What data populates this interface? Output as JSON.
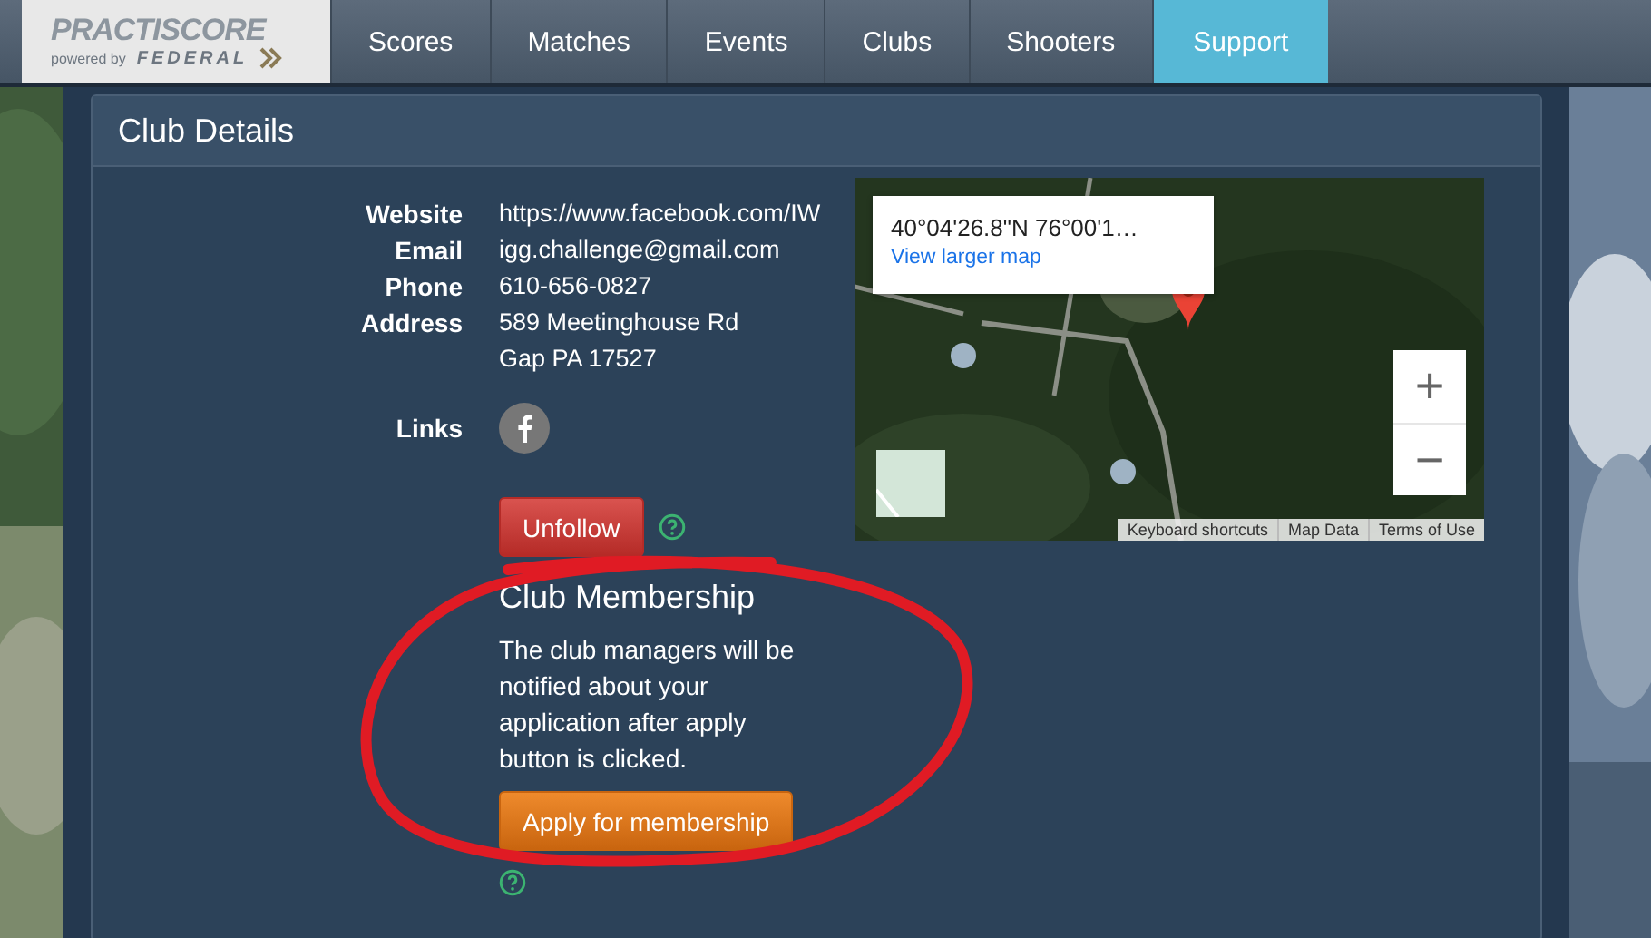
{
  "nav": {
    "logo": {
      "title": "PRACTISCORE",
      "tagline": "powered by",
      "brand": "FEDERAL"
    },
    "items": [
      {
        "label": "Scores",
        "selected": false
      },
      {
        "label": "Matches",
        "selected": false
      },
      {
        "label": "Events",
        "selected": false
      },
      {
        "label": "Clubs",
        "selected": false
      },
      {
        "label": "Shooters",
        "selected": false
      },
      {
        "label": "Support",
        "selected": true
      }
    ]
  },
  "panel": {
    "title": "Club Details",
    "details": [
      {
        "label": "Website",
        "lines": [
          "https://www.facebook.com/IW"
        ]
      },
      {
        "label": "Email",
        "lines": [
          "igg.challenge@gmail.com"
        ]
      },
      {
        "label": "Phone",
        "lines": [
          "610-656-0827"
        ]
      },
      {
        "label": "Address",
        "lines": [
          "589 Meetinghouse Rd",
          "Gap PA 17527"
        ]
      }
    ],
    "links_label": "Links",
    "unfollow_button": "Unfollow",
    "map": {
      "coordinates": "40°04'26.8\"N 76°00'1…",
      "link": "View larger map",
      "zoom": [
        "+",
        "−"
      ],
      "attribution": [
        "Keyboard shortcuts",
        "Map Data",
        "Terms of Use"
      ]
    },
    "membership": {
      "title": "Club Membership",
      "text": "The club managers will be notified about your application after apply button is clicked.",
      "button": "Apply for membership"
    }
  }
}
